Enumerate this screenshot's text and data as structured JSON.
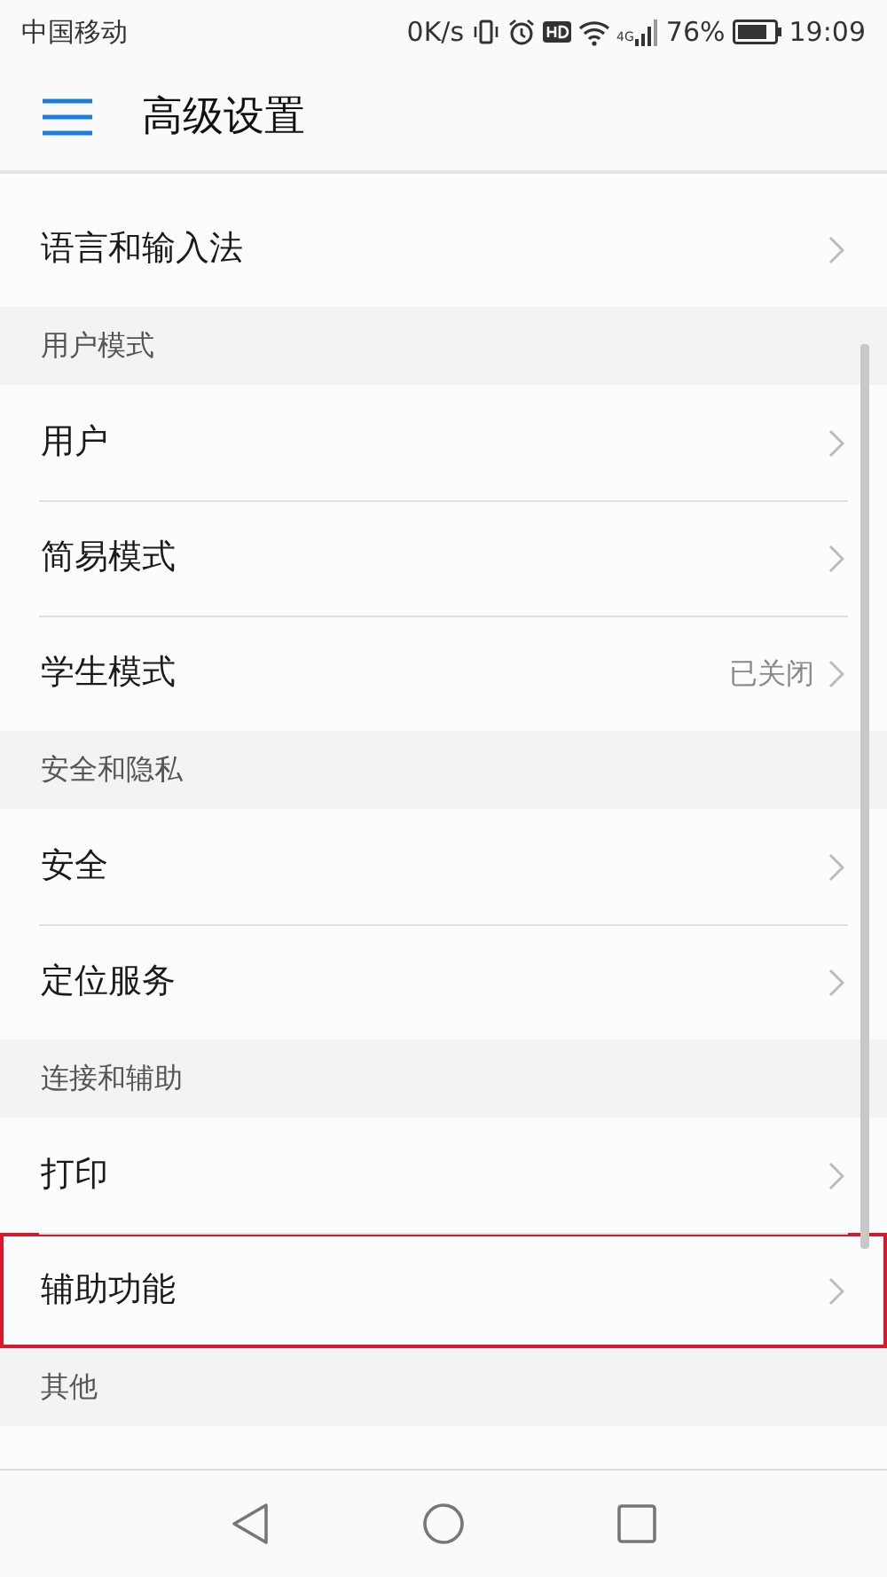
{
  "status_bar": {
    "carrier": "中国移动",
    "speed": "0K/s",
    "network": "4G",
    "battery": "76%",
    "time": "19:09"
  },
  "header": {
    "title": "高级设置"
  },
  "sections": [
    {
      "items": [
        {
          "label": "语言和输入法",
          "highlighted": false
        }
      ]
    },
    {
      "title": "用户模式",
      "items": [
        {
          "label": "用户",
          "highlighted": false
        },
        {
          "label": "简易模式",
          "highlighted": false
        },
        {
          "label": "学生模式",
          "value": "已关闭",
          "highlighted": false
        }
      ]
    },
    {
      "title": "安全和隐私",
      "items": [
        {
          "label": "安全",
          "highlighted": false
        },
        {
          "label": "定位服务",
          "highlighted": false
        }
      ]
    },
    {
      "title": "连接和辅助",
      "items": [
        {
          "label": "打印",
          "highlighted": false
        },
        {
          "label": "辅助功能",
          "highlighted": true
        }
      ]
    },
    {
      "title": "其他"
    }
  ]
}
